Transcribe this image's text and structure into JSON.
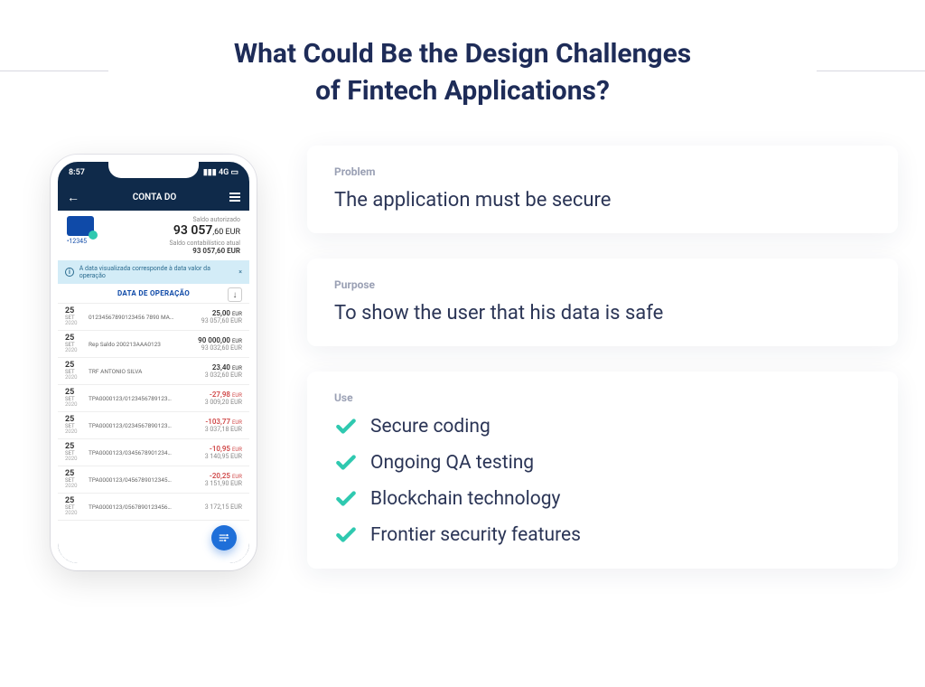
{
  "title_line1": "What Could Be the Design Challenges",
  "title_line2": "of Fintech Applications?",
  "phone": {
    "status_time": "8:57",
    "status_net": "4G",
    "app_title": "CONTA DO",
    "acct_mask": "•12345",
    "balance_label": "Saldo autorizado",
    "balance_int": "93 057",
    "balance_dec": ",60 EUR",
    "balance_sub_label": "Saldo contabilístico atual",
    "balance_sub_val": "93 057,60 EUR",
    "info_text": "A data visualizada corresponde à data valor da operação",
    "op_header": "DATA DE OPERAÇÃO",
    "transactions": [
      {
        "day": "25",
        "mon": "SET",
        "yr": "2020",
        "desc": "01234567890123456 7890 MA…",
        "amt": "25,00",
        "neg": false,
        "bal": "93 057,60 EUR"
      },
      {
        "day": "25",
        "mon": "SET",
        "yr": "2020",
        "desc": "Rep Saldo    200213AAA0123",
        "amt": "90 000,00",
        "neg": false,
        "bal": "93 032,60 EUR"
      },
      {
        "day": "25",
        "mon": "SET",
        "yr": "2020",
        "desc": "TRF ANTONIO SILVA",
        "amt": "23,40",
        "neg": false,
        "bal": "3 032,60 EUR"
      },
      {
        "day": "25",
        "mon": "SET",
        "yr": "2020",
        "desc": "TPA0000123/0123456789123…",
        "amt": "-27,98",
        "neg": true,
        "bal": "3 009,20 EUR"
      },
      {
        "day": "25",
        "mon": "SET",
        "yr": "2020",
        "desc": "TPA0000123/0234567890123…",
        "amt": "-103,77",
        "neg": true,
        "bal": "3 037,18 EUR"
      },
      {
        "day": "25",
        "mon": "SET",
        "yr": "2020",
        "desc": "TPA0000123/0345678901234…",
        "amt": "-10,95",
        "neg": true,
        "bal": "3 140,95 EUR"
      },
      {
        "day": "25",
        "mon": "SET",
        "yr": "2020",
        "desc": "TPA0000123/0456789012345…",
        "amt": "-20,25",
        "neg": true,
        "bal": "3 151,90 EUR"
      },
      {
        "day": "25",
        "mon": "SET",
        "yr": "2020",
        "desc": "TPA0000123/0567890123456…",
        "amt": "",
        "neg": false,
        "bal": "3 172,15 EUR"
      }
    ]
  },
  "cards": {
    "problem_label": "Problem",
    "problem_text": "The application must be secure",
    "purpose_label": "Purpose",
    "purpose_text": "To show the user that his data is safe",
    "use_label": "Use",
    "use_items": [
      "Secure coding",
      "Ongoing QA testing",
      "Blockchain technology",
      "Frontier security features"
    ]
  }
}
